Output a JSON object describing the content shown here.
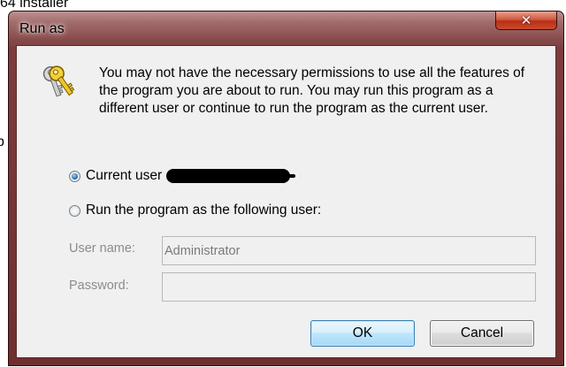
{
  "background": {
    "top_text": "64 installer",
    "left_text": "p"
  },
  "window": {
    "title": "Run as",
    "close_glyph": "✕"
  },
  "dialog": {
    "icon": "keys-icon",
    "message": "You may not have the necessary permissions to use all the features of the program you are about to run. You may run this program as a different user or continue to run the program as the current user.",
    "options": {
      "current_user_label": "Current user",
      "current_user_selected": true,
      "other_user_label": "Run the program as the following user:",
      "other_user_selected": false
    },
    "fields": {
      "username_label": "User name:",
      "username_value": "Administrator",
      "password_label": "Password:",
      "password_value": ""
    },
    "buttons": {
      "ok_label": "OK",
      "cancel_label": "Cancel"
    }
  },
  "colors": {
    "title_bar": "#7e3d3d",
    "close_button": "#c84c2e",
    "client_bg": "#f0f0f0",
    "ok_border": "#3c7fb1"
  }
}
